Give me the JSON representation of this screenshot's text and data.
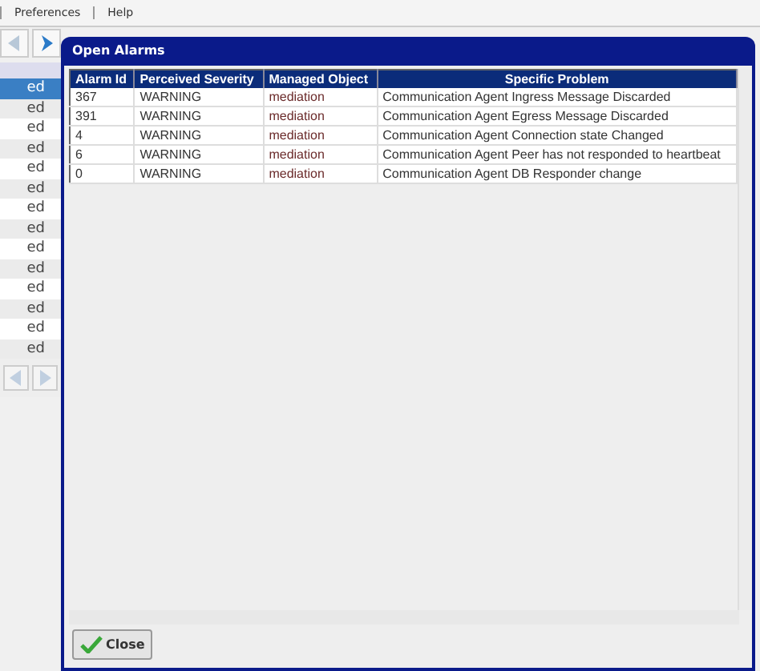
{
  "menu": [
    "Preferences",
    "Help"
  ],
  "background_list": {
    "rows": [
      {
        "text": "ed",
        "selected": true
      },
      {
        "text": "ed",
        "selected": false
      },
      {
        "text": "ed",
        "selected": false
      },
      {
        "text": "ed",
        "selected": false
      },
      {
        "text": "ed",
        "selected": false
      },
      {
        "text": "ed",
        "selected": false
      },
      {
        "text": "ed",
        "selected": false
      },
      {
        "text": "ed",
        "selected": false
      },
      {
        "text": "ed",
        "selected": false
      },
      {
        "text": "ed",
        "selected": false
      },
      {
        "text": "ed",
        "selected": false
      },
      {
        "text": "ed",
        "selected": false
      },
      {
        "text": "ed",
        "selected": false
      },
      {
        "text": "ed",
        "selected": false
      }
    ]
  },
  "dialog": {
    "title": "Open Alarms",
    "table": {
      "columns": [
        "Alarm Id",
        "Perceived Severity",
        "Managed Object",
        "Specific Problem"
      ],
      "rows": [
        [
          "367",
          "WARNING",
          "mediation",
          "Communication Agent Ingress Message Discarded"
        ],
        [
          "391",
          "WARNING",
          "mediation",
          "Communication Agent Egress Message Discarded"
        ],
        [
          "4",
          "WARNING",
          "mediation",
          "Communication Agent Connection state Changed"
        ],
        [
          "6",
          "WARNING",
          "mediation",
          "Communication Agent Peer has not responded to heartbeat"
        ],
        [
          "0",
          "WARNING",
          "mediation",
          "Communication Agent DB Responder change"
        ]
      ]
    },
    "close_button": "Close"
  }
}
